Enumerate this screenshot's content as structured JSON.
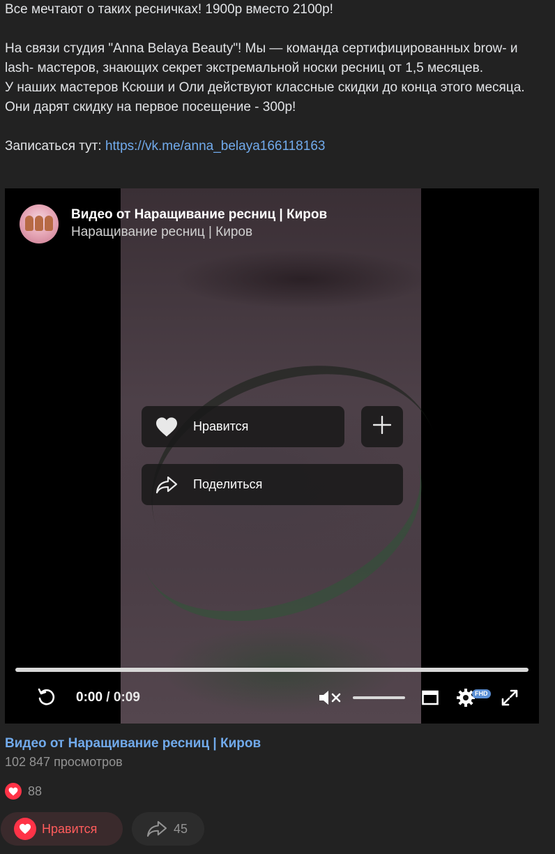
{
  "post": {
    "line1": "Все мечтают о таких ресничках! 1900р вместо 2100р!",
    "line2": "На связи студия \"Anna Belaya Beauty\"! Мы — команда сертифицированных brow- и lash- мастеров, знающих секрет экстремальной носки ресниц от 1,5 месяцев.",
    "line3": "У наших мастеров Ксюши и Оли действуют классные скидки до конца этого месяца. Они дарят скидку на первое посещение - 300р!",
    "signup_label": "Записаться тут: ",
    "signup_link": "https://vk.me/anna_belaya166118163"
  },
  "video": {
    "title": "Видео от Наращивание ресниц | Киров",
    "channel": "Наращивание ресниц | Киров",
    "overlay": {
      "like_label": "Нравится",
      "share_label": "Поделиться"
    },
    "time_current": "0:00",
    "time_separator": " / ",
    "time_total": "0:09",
    "quality_badge": "FHD",
    "progress_fraction": 0,
    "volume_muted": true
  },
  "below": {
    "title": "Видео от Наращивание ресниц | Киров",
    "views": "102 847 просмотров",
    "likes_count": "88"
  },
  "actions": {
    "like_label": "Нравится",
    "share_count": "45"
  },
  "colors": {
    "background": "#222222",
    "link": "#71aaeb",
    "like_red": "#ff3347"
  },
  "icons": [
    "avatar",
    "heart-icon",
    "plus-icon",
    "share-icon",
    "replay-icon",
    "mute-icon",
    "theater-mode-icon",
    "settings-icon",
    "fullscreen-icon"
  ]
}
